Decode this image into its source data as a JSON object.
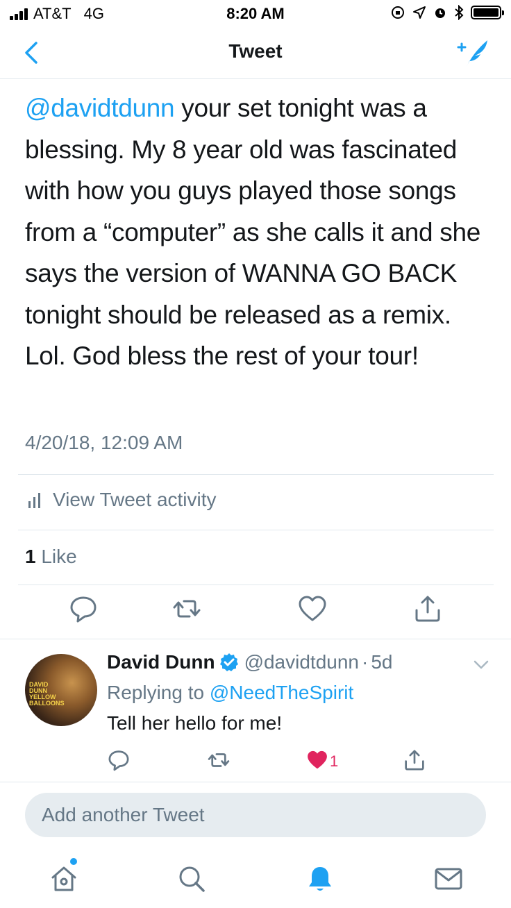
{
  "status_bar": {
    "carrier": "AT&T",
    "network": "4G",
    "time": "8:20 AM"
  },
  "nav": {
    "title": "Tweet"
  },
  "tweet": {
    "mention": "@davidtdunn",
    "text": " your set tonight was a blessing. My 8 year old was fascinated with how you guys played those songs from a “computer” as she calls it and she says the version of WANNA GO BACK tonight should be released as a remix. Lol. God bless the rest of your tour!",
    "timestamp": "4/20/18, 12:09 AM",
    "activity_label": "View Tweet activity",
    "like_count": "1",
    "like_label": "Like"
  },
  "reply": {
    "avatar_text": "DAVID DUNN YELLOW BALLOONS",
    "name": "David Dunn",
    "handle": "@davidtdunn",
    "separator": "·",
    "age": "5d",
    "replying_prefix": "Replying to ",
    "replying_to": "@NeedTheSpirit",
    "text": "Tell her hello for me!",
    "likes": "1"
  },
  "composer": {
    "placeholder": "Add another Tweet"
  },
  "colors": {
    "accent": "#1da1f2",
    "muted": "#657786",
    "like": "#e0245e",
    "divider": "#e1e8ed"
  },
  "icons": {
    "back": "chevron-left-icon",
    "compose": "compose-feather-icon",
    "activity": "bar-chart-icon",
    "reply": "reply-bubble-icon",
    "retweet": "retweet-icon",
    "like": "heart-icon",
    "share": "share-icon",
    "tabs": [
      "home-icon",
      "search-icon",
      "notifications-bell-icon",
      "messages-envelope-icon"
    ]
  }
}
